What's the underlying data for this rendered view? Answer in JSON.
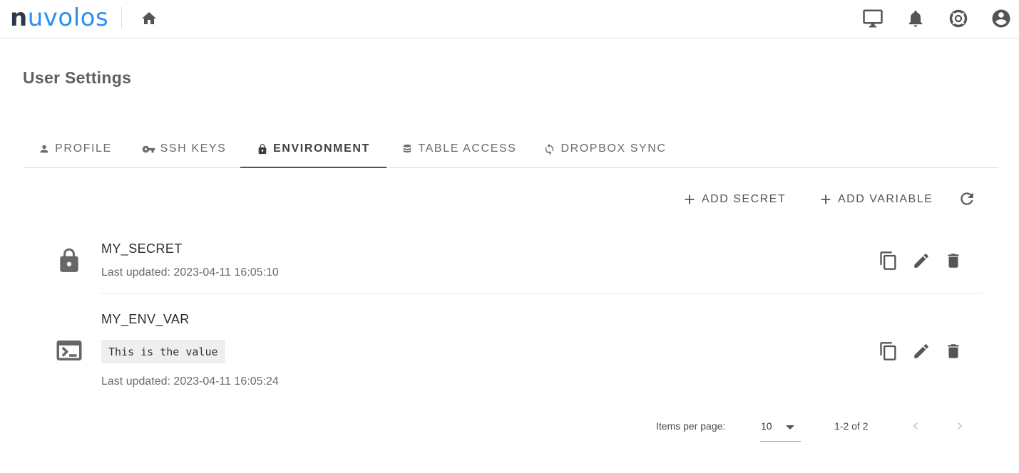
{
  "app": {
    "logo_n": "n",
    "logo_rest": "uvolos",
    "brand_color": "#2e8ff0"
  },
  "header": {
    "icons": [
      "home-icon",
      "monitor-icon",
      "bell-icon",
      "lifebuoy-icon",
      "account-circle-icon"
    ]
  },
  "page": {
    "title": "User Settings"
  },
  "tabs": [
    {
      "label": "PROFILE",
      "icon": "person-icon",
      "active": false
    },
    {
      "label": "SSH KEYS",
      "icon": "key-icon",
      "active": false
    },
    {
      "label": "ENVIRONMENT",
      "icon": "lock-icon",
      "active": true
    },
    {
      "label": "TABLE ACCESS",
      "icon": "database-icon",
      "active": false
    },
    {
      "label": "DROPBOX SYNC",
      "icon": "sync-icon",
      "active": false
    }
  ],
  "actions": {
    "add_secret": "ADD SECRET",
    "add_variable": "ADD VARIABLE",
    "refresh_icon": "refresh-icon"
  },
  "items": [
    {
      "type": "secret",
      "icon": "lock-icon",
      "name": "MY_SECRET",
      "value": "",
      "updated": "Last updated: 2023-04-11 16:05:10"
    },
    {
      "type": "variable",
      "icon": "console-icon",
      "name": "MY_ENV_VAR",
      "value": "This is the value",
      "updated": "Last updated: 2023-04-11 16:05:24"
    }
  ],
  "row_actions": [
    "copy-icon",
    "pencil-icon",
    "trash-icon"
  ],
  "pagination": {
    "label": "Items per page:",
    "per_page": "10",
    "range": "1-2 of 2",
    "prev_enabled": false,
    "next_enabled": false
  }
}
